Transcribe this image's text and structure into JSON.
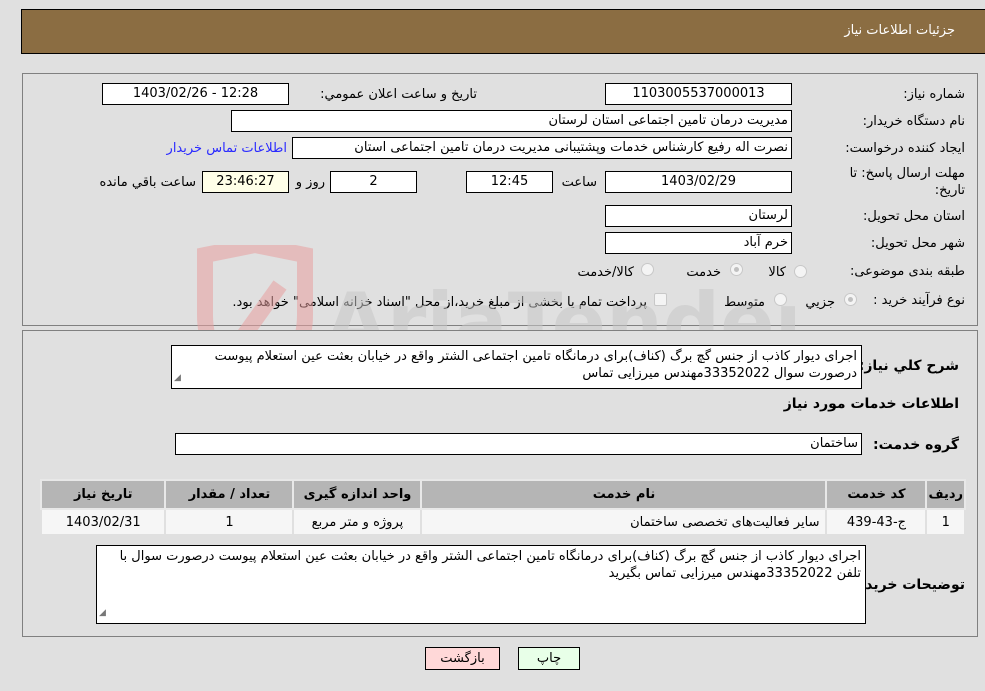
{
  "header": {
    "title": "جزئیات اطلاعات نیاز"
  },
  "form": {
    "need_number": {
      "label": "شماره نیاز:",
      "value": "1103005537000013"
    },
    "announce_datetime": {
      "label": "تاریخ و ساعت اعلان عمومي:",
      "value": "1403/02/26 - 12:28"
    },
    "buyer_org": {
      "label": "نام دستگاه خریدار:",
      "value": "مدیریت درمان تامین اجتماعی استان لرستان"
    },
    "requester": {
      "label": "ایجاد کننده درخواست:",
      "value": "نصرت اله رفیع کارشناس خدمات وپشتیبانی مدیریت درمان تامین اجتماعی استان",
      "contact_link": "اطلاعات تماس خریدار"
    },
    "deadline": {
      "label": "مهلت ارسال پاسخ: تا تاریخ:",
      "date": "1403/02/29",
      "time_label": "ساعت",
      "time": "12:45",
      "days": "2",
      "days_label": "روز و",
      "remaining": "23:46:27",
      "remaining_label": "ساعت باقي مانده"
    },
    "province": {
      "label": "استان محل تحویل:",
      "value": "لرستان"
    },
    "city": {
      "label": "شهر محل تحویل:",
      "value": "خرم آباد"
    },
    "category": {
      "label": "طبقه بندی موضوعی:",
      "options": [
        "کالا",
        "خدمت",
        "کالا/خدمت"
      ],
      "selected": "خدمت"
    },
    "purchase_type": {
      "label": "نوع فرآیند خرید :",
      "options": [
        "جزیي",
        "متوسط"
      ],
      "selected": "جزیي",
      "treasury_note": "پرداخت تمام یا بخشی از مبلغ خرید،از محل \"اسناد خزانه اسلامی\" خواهد بود."
    }
  },
  "details": {
    "summary_label": "شرح کلي نیاز:",
    "summary_value": "اجرای دیوار کاذب از جنس گچ برگ (کناف)برای درمانگاه تامین اجتماعی الشتر واقع در خیابان بعثت عین استعلام پیوست درصورت سوال  33352022مهندس میرزایی تماس",
    "services_heading": "اطلاعات خدمات مورد نیاز",
    "service_group_label": "گروه خدمت:",
    "service_group_value": "ساختمان",
    "table": {
      "headers": [
        "ردیف",
        "کد خدمت",
        "نام خدمت",
        "واحد اندازه گیری",
        "تعداد / مقدار",
        "تاریخ نیاز"
      ],
      "rows": [
        [
          "1",
          "ج-43-439",
          "سایر فعالیت‌های تخصصی ساختمان",
          "پروژه و متر مربع",
          "1",
          "1403/02/31"
        ]
      ]
    },
    "buyer_notes_label": "توضیحات خریدار:",
    "buyer_notes_value": "اجرای دیوار کاذب از جنس گچ برگ (کناف)برای درمانگاه تامین اجتماعی الشتر واقع در خیابان بعثت عین استعلام پیوست درصورت سوال با تلفن 33352022مهندس میرزایی تماس بگیرید"
  },
  "buttons": {
    "print": "چاپ",
    "back": "بازگشت"
  },
  "watermark": {
    "text": "AriaTender.neT"
  }
}
